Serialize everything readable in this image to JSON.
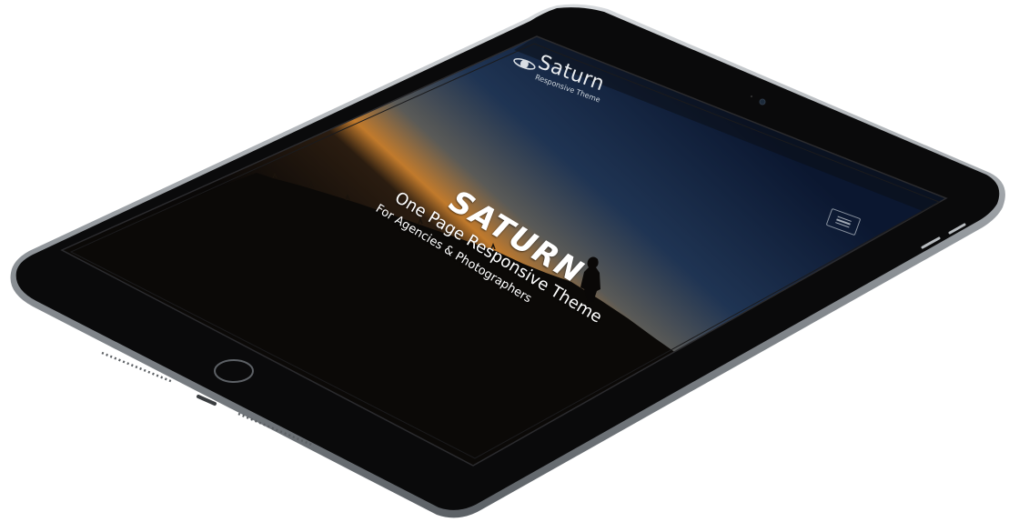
{
  "site": {
    "brand_name": "Saturn",
    "brand_tagline": "Responsive Theme",
    "logo_icon": "saturn-ring-logo-icon",
    "menu_icon": "hamburger-menu-icon"
  },
  "hero": {
    "title": "SATURN",
    "subtitle": "One Page Responsive Theme",
    "tagline": "For Agencies & Photographers"
  },
  "colors": {
    "bezel": "#0b0b0c",
    "device_frame": "#9aa0a6",
    "sky_top": "#0c1a33",
    "sky_horizon": "#c77a2a",
    "ground": "#0d0b09",
    "text": "#ffffff"
  }
}
